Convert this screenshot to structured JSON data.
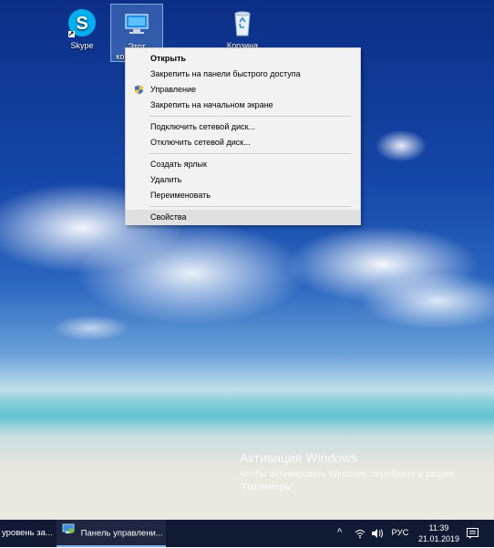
{
  "desktop": {
    "icons": [
      {
        "label": "Skype"
      },
      {
        "label": "Этот компьютер"
      },
      {
        "label": "Корзина"
      }
    ]
  },
  "context_menu": {
    "items": [
      {
        "label": "Открыть"
      },
      {
        "label": "Закрепить на панели быстрого доступа"
      },
      {
        "label": "Управление"
      },
      {
        "label": "Закрепить на начальном экране"
      },
      {
        "label": "Подключить сетевой диск..."
      },
      {
        "label": "Отключить сетевой диск..."
      },
      {
        "label": "Создать ярлык"
      },
      {
        "label": "Удалить"
      },
      {
        "label": "Переименовать"
      },
      {
        "label": "Свойства"
      }
    ]
  },
  "watermark": {
    "title": "Активация Windows",
    "subtitle": "Чтобы активировать Windows, перейдите в раздел \"Параметры\"."
  },
  "taskbar": {
    "items": [
      {
        "label": "уровень за..."
      },
      {
        "label": "Панель управлени..."
      }
    ],
    "tray": {
      "language": "РУС",
      "time": "11:39",
      "date": "21.01.2019"
    }
  },
  "colors": {
    "taskbar_bg": "#101a33",
    "menu_bg": "#f2f2f2",
    "menu_hover": "#e0e0e0",
    "skype_blue": "#00aff0"
  }
}
